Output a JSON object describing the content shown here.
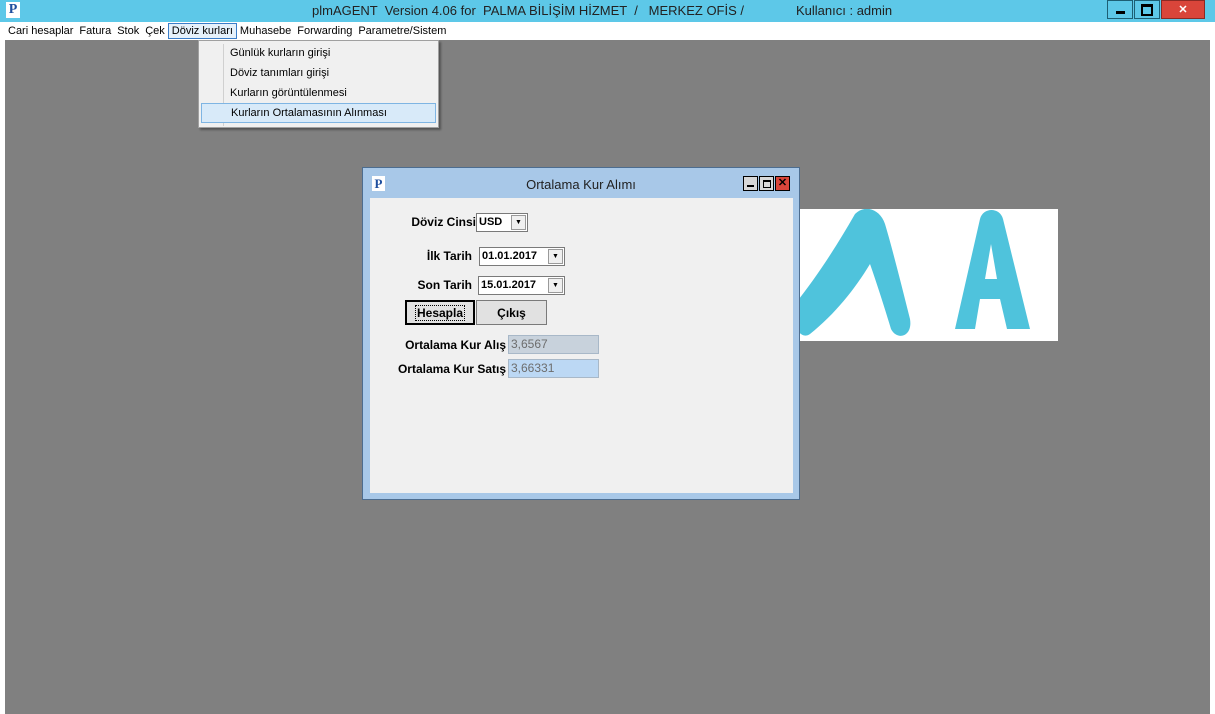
{
  "window": {
    "title": "plmAGENT  Version 4.06 for  PALMA BİLİŞİM HİZMET  /   MERKEZ OFİS /",
    "user": "Kullanıcı : admin",
    "logo_letter": "P",
    "controls": [
      "minimize-icon",
      "restore-icon",
      "close-icon"
    ]
  },
  "menubar": {
    "items": [
      {
        "label": "Cari hesaplar"
      },
      {
        "label": "Fatura"
      },
      {
        "label": "Stok"
      },
      {
        "label": "Çek"
      },
      {
        "label": "Döviz kurları"
      },
      {
        "label": "Muhasebe"
      },
      {
        "label": "Forwarding"
      },
      {
        "label": "Parametre/Sistem"
      }
    ],
    "active_index": 4
  },
  "dropdown": {
    "items": [
      {
        "label": "Günlük kurların girişi"
      },
      {
        "label": "Döviz tanımları girişi"
      },
      {
        "label": "Kurların görüntülenmesi"
      },
      {
        "label": "Kurların Ortalamasının Alınması"
      }
    ],
    "highlighted_index": 3
  },
  "dialog": {
    "title": "Ortalama Kur Alımı",
    "logo_letter": "P",
    "currency": {
      "label": "Döviz Cinsi",
      "value": "USD"
    },
    "start_date": {
      "label": "İlk Tarih",
      "value": "01.01.2017"
    },
    "end_date": {
      "label": "Son Tarih",
      "value": "15.01.2017"
    },
    "calc_button": "Hesapla",
    "exit_button": "Çıkış",
    "avg_buy": {
      "label": "Ortalama Kur Alış",
      "value": "3,6567"
    },
    "avg_sell": {
      "label": "Ortalama Kur Satış",
      "value": "3,66331"
    }
  },
  "colors": {
    "titlebar": "#5dc8e8",
    "workspace": "#808080",
    "logo_accent": "#4fc3dc",
    "dialog_frame": "#a8c8e8",
    "buy_field_bg": "#c8d2dc",
    "sell_field_bg": "#bcd8f4"
  }
}
